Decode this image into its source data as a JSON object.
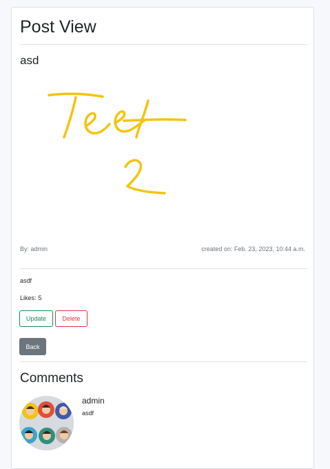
{
  "page": {
    "title": "Post View"
  },
  "post": {
    "title": "asd",
    "image_alt": "Text 2",
    "author_prefix": "By:",
    "author": "admin",
    "created_label": "created on: Feb. 23, 2023, 10:44 a.m.",
    "body": "asdf",
    "likes_label": "Likes:",
    "likes": "5"
  },
  "actions": {
    "update": "Update",
    "delete": "Delete",
    "back": "Back"
  },
  "comments": {
    "heading": "Comments",
    "items": [
      {
        "author": "admin",
        "text": "asdf"
      }
    ]
  },
  "colors": {
    "update": "#198754",
    "delete": "#dc3545",
    "back": "#6c757d",
    "drawing": "#f2c40f"
  }
}
